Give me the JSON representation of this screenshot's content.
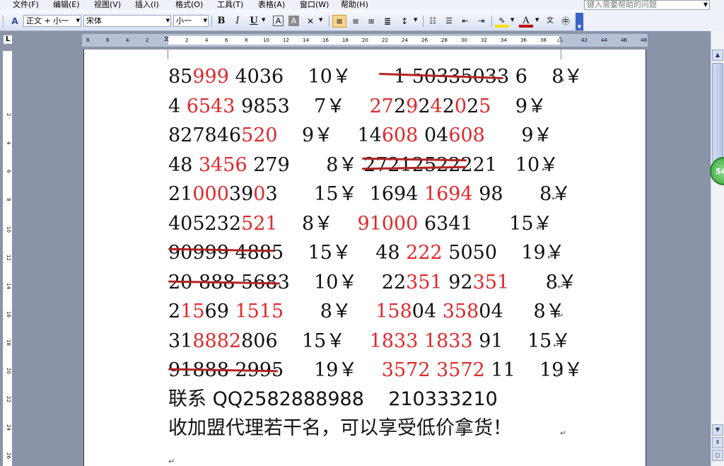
{
  "menu": {
    "items": [
      "文件(F)",
      "编辑(E)",
      "视图(V)",
      "插入(I)",
      "格式(O)",
      "工具(T)",
      "表格(A)",
      "窗口(W)",
      "帮助(H)"
    ],
    "help_placeholder": "键入需要帮助的问题"
  },
  "toolbar": {
    "style_value": "正文 + 小一",
    "font_value": "宋体",
    "size_value": "小一",
    "bold_label": "B",
    "italic_label": "I",
    "underline_label": "U"
  },
  "ruler": {
    "h_ticks": [
      "8",
      "6",
      "4",
      "2",
      "",
      "2",
      "4",
      "6",
      "8",
      "10",
      "12",
      "14",
      "16",
      "18",
      "20",
      "22",
      "24",
      "26",
      "28",
      "30",
      "32",
      "34",
      "36",
      "38",
      "",
      "42",
      "44",
      "46",
      "48"
    ],
    "v_ticks": [
      "2",
      "4",
      "6",
      "8",
      "10",
      "12",
      "14",
      "16",
      "18",
      "20",
      "22",
      "24",
      "26"
    ]
  },
  "scroll": {
    "page_badge": "54"
  },
  "document": {
    "lines": [
      {
        "a1": "85",
        "a2": "999",
        "a3": " 4036",
        "p1": "    10￥       ",
        "b": "1 50335033 6",
        "p2": "    8￥"
      },
      {
        "a1": "4 ",
        "a2": "6543",
        "a3": " 9853",
        "p1": "    7￥    ",
        "b1": "27",
        "b2": "2",
        "b3": "9",
        "b4": "2",
        "b5": "4",
        "b6": "2",
        "b7": "0",
        "b8": "2",
        "b9": "5",
        "p2": "    9￥"
      },
      {
        "a1": "827846",
        "a2": "520",
        "p1": "    9￥    ",
        "b1": "14",
        "b2": "608",
        "b3": " 04",
        "b4": "608",
        "p2": "      9￥"
      },
      {
        "a1": "48 ",
        "a2": "3456",
        "a3": " 279",
        "p1": "      8￥ ",
        "b": "2721252222",
        "b_end": "1",
        "p2": "   10￥"
      },
      {
        "a1": "21",
        "a2": "000",
        "a3": "39",
        "a4": "0",
        "a5": "3",
        "p1": "      15￥  1694 ",
        "b2": "1694",
        "b3": " 98",
        "p2": "      8￥"
      },
      {
        "a1": "405232",
        "a2": "521",
        "p1": "    8￥    ",
        "b1": "91000",
        "b2": " 6341",
        "p2": "      15￥"
      },
      {
        "a": "90999 4885",
        "p1": "    15￥    48 ",
        "b2": "222",
        "b3": " 5050",
        "p2": "    19￥"
      },
      {
        "a": "20 888 5683",
        "p1": "    10￥    22",
        "b2": "351",
        "b3": " 92",
        "b4": "351",
        "p2": "      8￥"
      },
      {
        "a1": "2",
        "a2": "15",
        "a3": "69 ",
        "a4": "1515",
        "p1": "      8￥    ",
        "b1": "158",
        "b2": "04 ",
        "b3": "358",
        "b4": "04",
        "p2": "     8￥"
      },
      {
        "a1": "31",
        "a2": "8882",
        "a3": "8",
        "a4": "06",
        "p1": "    15￥    ",
        "b1": "1833 1833",
        "b2": " 91",
        "p2": "    15￥"
      },
      {
        "a": "91888 2995",
        "p1": "     19￥    ",
        "b1": "3572 3572",
        "b2": " 11",
        "p2": "    19￥"
      },
      {
        "text": "联系 QQ2582888988    210333210"
      },
      {
        "text": "收加盟代理若干名，可以享受低价拿货！"
      }
    ]
  },
  "colors": {
    "red_text": "#e0282b",
    "strike": "#b02522",
    "toolbar_bg": "#d9e2f3",
    "workspace": "#8b93a8"
  }
}
